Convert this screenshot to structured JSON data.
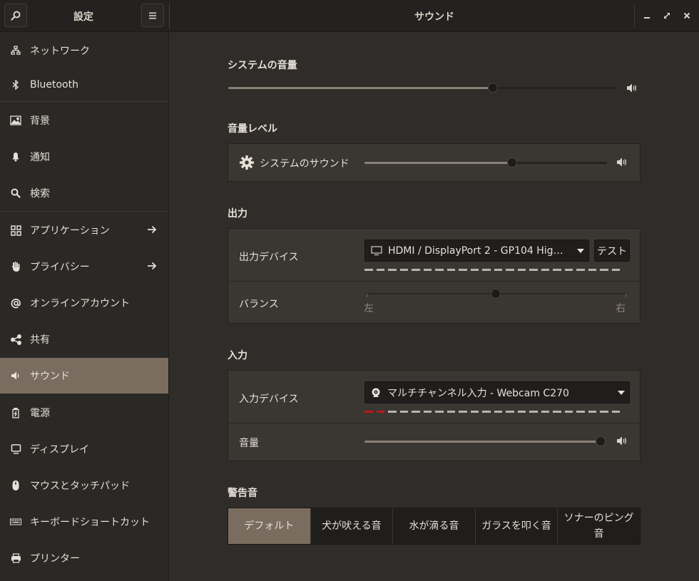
{
  "header": {
    "left_title": "設定",
    "main_title": "サウンド",
    "window_buttons": [
      "minimize-icon",
      "maximize-icon",
      "close-icon"
    ]
  },
  "sidebar": {
    "items": [
      {
        "label": "ネットワーク",
        "icon": "network-icon"
      },
      {
        "label": "Bluetooth",
        "icon": "bluetooth-icon"
      },
      {
        "label": "背景",
        "icon": "image-icon"
      },
      {
        "label": "通知",
        "icon": "bell-icon"
      },
      {
        "label": "検索",
        "icon": "search-icon"
      },
      {
        "label": "アプリケーション",
        "icon": "apps-grid-icon",
        "arrow": true
      },
      {
        "label": "プライバシー",
        "icon": "hand-icon",
        "arrow": true
      },
      {
        "label": "オンラインアカウント",
        "icon": "at-icon"
      },
      {
        "label": "共有",
        "icon": "share-icon"
      },
      {
        "label": "サウンド",
        "icon": "speaker-icon",
        "active": true
      },
      {
        "label": "電源",
        "icon": "battery-icon"
      },
      {
        "label": "ディスプレイ",
        "icon": "display-icon"
      },
      {
        "label": "マウスとタッチパッド",
        "icon": "mouse-icon"
      },
      {
        "label": "キーボードショートカット",
        "icon": "keyboard-icon"
      },
      {
        "label": "プリンター",
        "icon": "printer-icon"
      }
    ]
  },
  "system_volume": {
    "title": "システムの音量",
    "level": 0.68
  },
  "volume_levels": {
    "title": "音量レベル",
    "system_sounds_label": "システムのサウンド",
    "level": 0.61
  },
  "output": {
    "title": "出力",
    "device_label": "出力デバイス",
    "device_value": "HDMI / DisplayPort 2 - GP104 Hig…",
    "test_label": "テスト",
    "balance_label": "バランス",
    "balance_value": 0.5,
    "balance_left": "左",
    "balance_right": "右"
  },
  "input": {
    "title": "入力",
    "device_label": "入力デバイス",
    "device_value": "マルチチャンネル入力 - Webcam C270",
    "volume_label": "音量",
    "volume_level": 1.0
  },
  "alert_sounds": {
    "title": "警告音",
    "options": [
      "デフォルト",
      "犬が吠える音",
      "水が滴る音",
      "ガラスを叩く音",
      "ソナーのピング音"
    ],
    "selected": "デフォルト"
  },
  "colors": {
    "accent": "#7a6d5f",
    "background": "#2f2c29",
    "level_red": "#c4161c"
  }
}
